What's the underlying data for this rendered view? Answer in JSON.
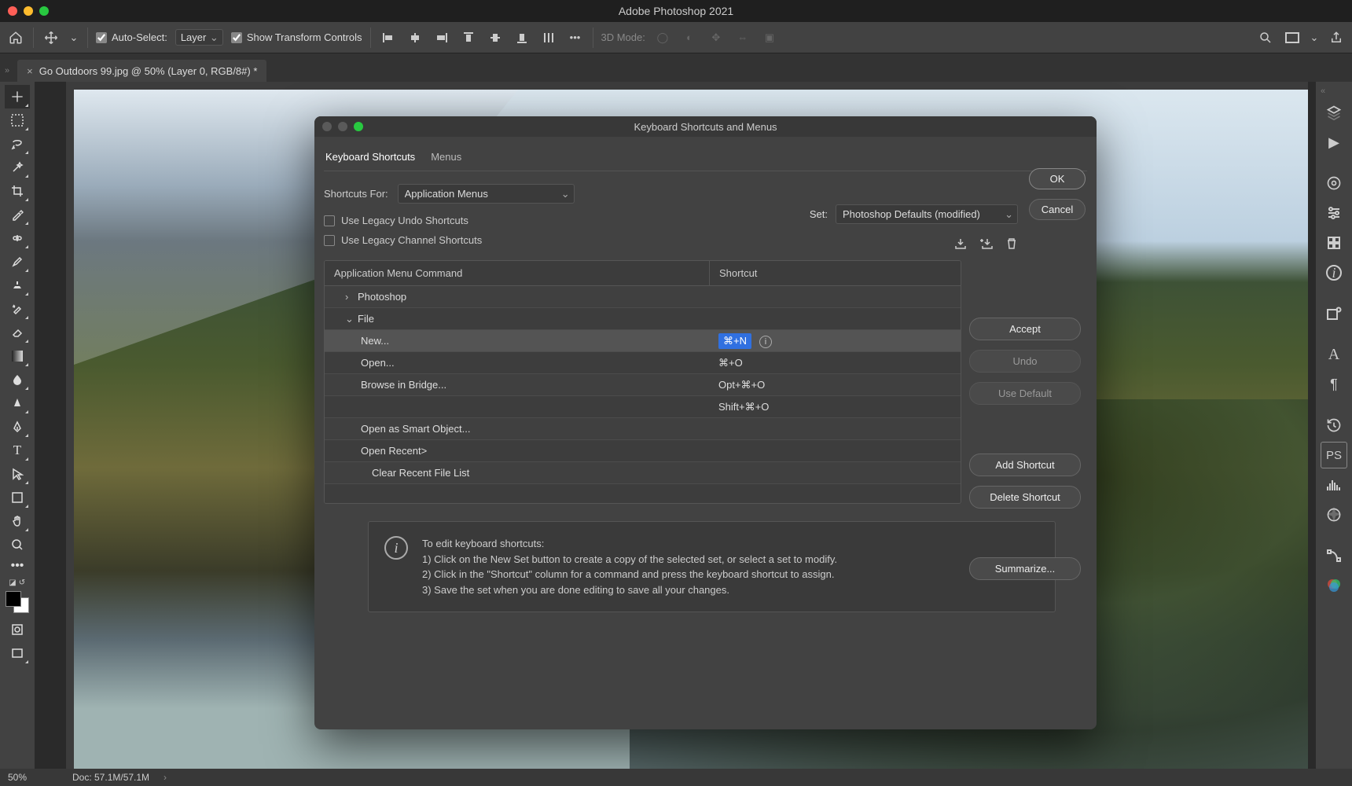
{
  "app": {
    "title": "Adobe Photoshop 2021"
  },
  "optionsbar": {
    "auto_select_label": "Auto-Select:",
    "auto_select_mode": "Layer",
    "show_transform_label": "Show Transform Controls",
    "mode3d_label": "3D Mode:"
  },
  "document_tab": {
    "title": "Go Outdoors 99.jpg @ 50% (Layer 0, RGB/8#) *"
  },
  "dialog": {
    "title": "Keyboard Shortcuts and Menus",
    "tabs": {
      "shortcuts": "Keyboard Shortcuts",
      "menus": "Menus"
    },
    "shortcuts_for_label": "Shortcuts For:",
    "shortcuts_for_value": "Application Menus",
    "set_label": "Set:",
    "set_value": "Photoshop Defaults (modified)",
    "legacy_undo": "Use Legacy Undo Shortcuts",
    "legacy_channel": "Use Legacy Channel Shortcuts",
    "col_cmd": "Application Menu Command",
    "col_sc": "Shortcut",
    "buttons": {
      "ok": "OK",
      "cancel": "Cancel",
      "accept": "Accept",
      "undo": "Undo",
      "use_default": "Use Default",
      "add_shortcut": "Add Shortcut",
      "delete_shortcut": "Delete Shortcut",
      "summarize": "Summarize..."
    },
    "rows": {
      "photoshop": "Photoshop",
      "file": "File",
      "new": "New...",
      "new_sc": "⌘+N",
      "open": "Open...",
      "open_sc": "⌘+O",
      "browse": "Browse in Bridge...",
      "browse_sc1": "Opt+⌘+O",
      "browse_sc2": "Shift+⌘+O",
      "open_smart": "Open as Smart Object...",
      "open_recent": "Open Recent>",
      "clear_recent": "Clear Recent File List"
    },
    "help": {
      "intro": "To edit keyboard shortcuts:",
      "l1": "1) Click on the New Set button to create a copy of the selected set, or select a set to modify.",
      "l2": "2) Click in the \"Shortcut\" column for a command and press the keyboard shortcut to assign.",
      "l3": "3) Save the set when you are done editing to save all your changes."
    }
  },
  "statusbar": {
    "zoom": "50%",
    "doc_size": "Doc: 57.1M/57.1M"
  }
}
